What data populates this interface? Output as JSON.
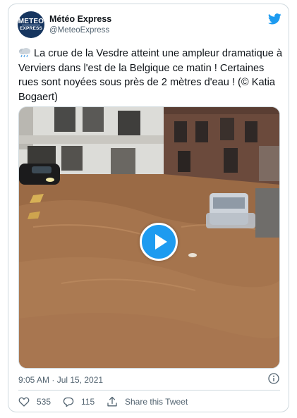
{
  "account": {
    "display_name": "Météo Express",
    "handle": "@MeteoExpress",
    "avatar_line1": "METEO",
    "avatar_line2": "EXPRESS"
  },
  "tweet": {
    "emoji": "cloud-with-rain",
    "text": "La crue de la Vesdre atteint une ampleur dramatique à Verviers dans l'est de la Belgique ce matin ! Certaines rues sont noyées sous près de 2 mètres d'eau ! (© Katia Bogaert)",
    "timestamp": "9:05 AM · Jul 15, 2021"
  },
  "media": {
    "type": "video",
    "play_icon": "play-icon"
  },
  "actions": {
    "likes": "535",
    "replies": "115",
    "share_label": "Share this Tweet"
  },
  "colors": {
    "accent": "#1d9bf0",
    "text": "#0f1419",
    "muted": "#536471",
    "border": "#cfd9de"
  }
}
